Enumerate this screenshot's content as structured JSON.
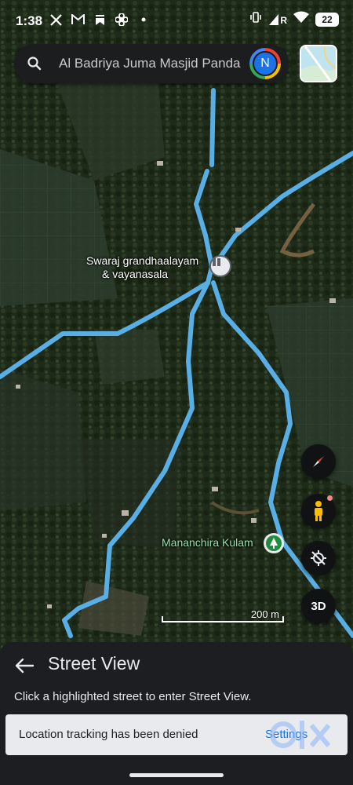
{
  "status_bar": {
    "time": "1:38",
    "battery": "22",
    "icons_left": [
      "x-icon",
      "gmail-icon",
      "bookmark-icon",
      "fan-icon",
      "dot-icon"
    ],
    "icons_right": [
      "signal-icon",
      "wifi-icon",
      "battery-icon"
    ],
    "signal_label": "R"
  },
  "search": {
    "text": "Al Badriya Juma Masjid Panda",
    "avatar_letter": "N"
  },
  "map": {
    "place_label_line1": "Swaraj grandhaalayam",
    "place_label_line2": "& vayanasala",
    "poi_label": "Mananchira Kulam",
    "scale_label": "200 m",
    "road_color": "#5aaee6",
    "poi_color": "#8fe3a6"
  },
  "controls": {
    "compass": "compass-icon",
    "pegman": "pegman-icon",
    "location": "location-off-icon",
    "three_d_label": "3D"
  },
  "sheet": {
    "title": "Street View",
    "description": "Click a highlighted street to enter Street View."
  },
  "toast": {
    "message": "Location tracking has been denied",
    "action": "Settings"
  }
}
